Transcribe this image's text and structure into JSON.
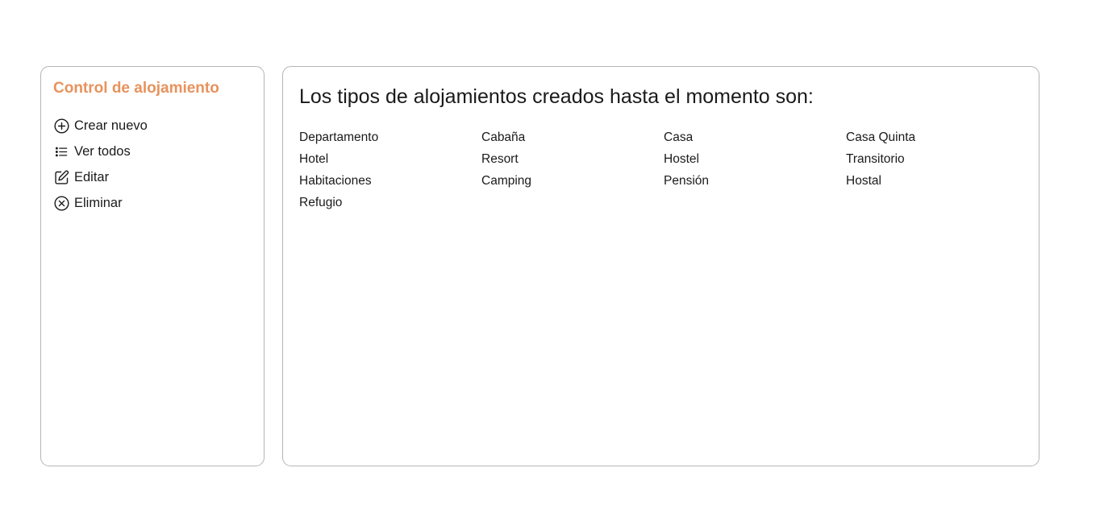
{
  "sidebar": {
    "title": "Control de alojamiento",
    "accent_color": "#e8925c",
    "items": [
      {
        "label": "Crear nuevo",
        "icon": "plus-circle-icon"
      },
      {
        "label": "Ver todos",
        "icon": "list-icon"
      },
      {
        "label": "Editar",
        "icon": "edit-icon"
      },
      {
        "label": "Eliminar",
        "icon": "x-circle-icon"
      }
    ]
  },
  "main": {
    "heading": "Los tipos de alojamientos creados hasta el momento son:",
    "types": [
      "Departamento",
      "Cabaña",
      "Casa",
      "Casa Quinta",
      "Hotel",
      "Resort",
      "Hostel",
      "Transitorio",
      "Habitaciones",
      "Camping",
      "Pensión",
      "Hostal",
      "Refugio"
    ]
  }
}
